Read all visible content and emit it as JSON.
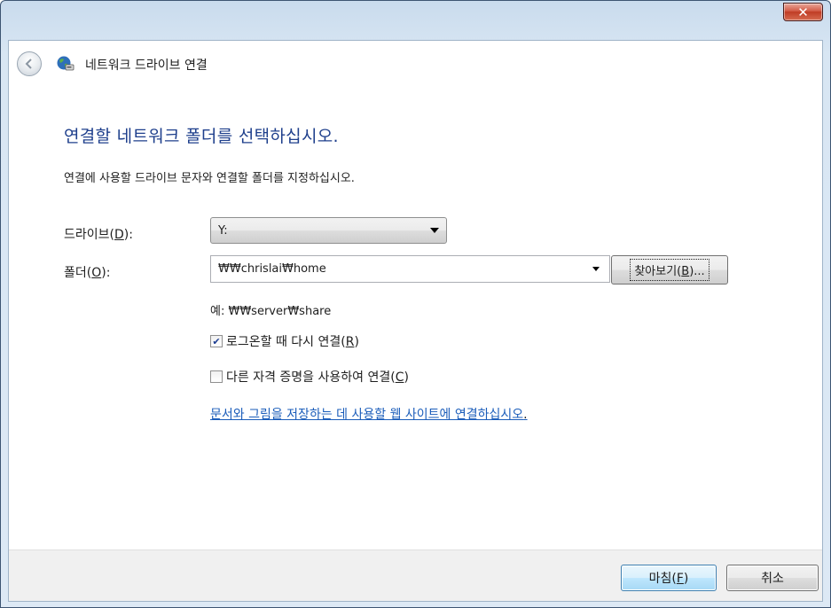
{
  "titlebar": {
    "close_label": "✕"
  },
  "nav": {
    "title": "네트워크 드라이브 연결"
  },
  "heading": "연결할 네트워크 폴더를 선택하십시오.",
  "description": "연결에 사용할 드라이브 문자와 연결할 폴더를 지정하십시오.",
  "drive": {
    "label_prefix": "드라이브(",
    "accel": "D",
    "label_suffix": "):",
    "value": "Y:"
  },
  "folder": {
    "label_prefix": "폴더(",
    "accel": "O",
    "label_suffix": "):",
    "value": "₩₩chrislai₩home"
  },
  "browse": {
    "prefix": "찾아보기(",
    "accel": "B",
    "suffix": ")..."
  },
  "example": "예: ₩₩server₩share",
  "reconnect": {
    "checked": true,
    "prefix": "로그온할 때 다시 연결(",
    "accel": "R",
    "suffix": ")"
  },
  "other_credentials": {
    "checked": false,
    "prefix": "다른 자격 증명을 사용하여 연결(",
    "accel": "C",
    "suffix": ")"
  },
  "link": {
    "text": "문서와 그림을 저장하는 데 사용할 웹 사이트에 연결하십시오",
    "trailing": "."
  },
  "buttons": {
    "finish": {
      "prefix": "마침(",
      "accel": "F",
      "suffix": ")"
    },
    "cancel": "취소"
  },
  "colors": {
    "heading": "#1e3f8c",
    "link": "#1b5dba",
    "close": "#c03c24"
  },
  "icons": {
    "back": "back-arrow-icon",
    "network": "network-drive-icon",
    "close": "close-icon",
    "dropdown": "dropdown-arrow-icon",
    "check": "checkmark-icon"
  }
}
